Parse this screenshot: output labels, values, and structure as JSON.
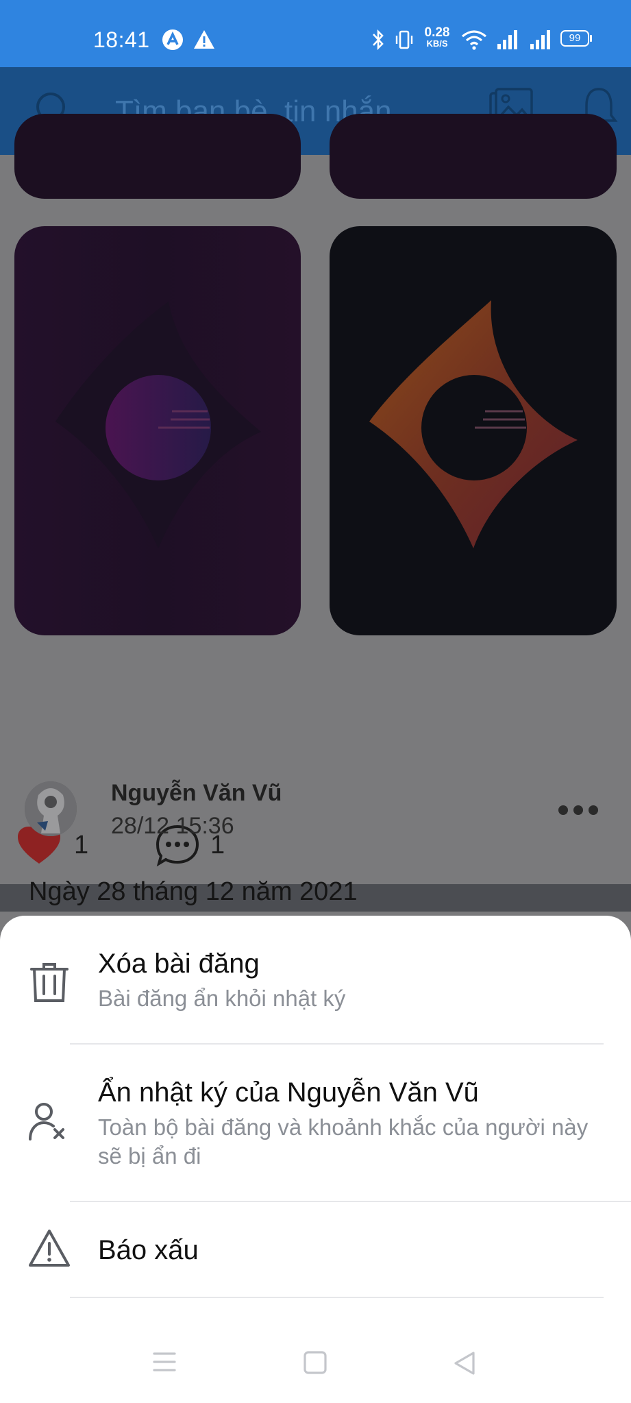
{
  "status_bar": {
    "time": "18:41",
    "speed_value": "0.28",
    "speed_unit": "KB/S",
    "battery": "99"
  },
  "header": {
    "search_placeholder": "Tìm bạn bè, tin nhắn ..."
  },
  "feed": {
    "like_count": "1",
    "comment_count": "1",
    "post": {
      "author": "Nguyễn Văn Vũ",
      "timestamp": "28/12 15:36",
      "body": "Ngày 28 tháng 12 năm 2021"
    }
  },
  "sheet": {
    "options": [
      {
        "title": "Xóa bài đăng",
        "subtitle": "Bài đăng ẩn khỏi nhật ký",
        "icon": "trash-icon"
      },
      {
        "title": "Ẩn nhật ký của Nguyễn Văn Vũ",
        "subtitle": "Toàn bộ bài đăng và khoảnh khắc của người này sẽ bị ẩn đi",
        "icon": "user-remove-icon"
      },
      {
        "title": "Báo xấu",
        "icon": "warning-icon"
      }
    ]
  },
  "colors": {
    "status_bar": "#2f84e0",
    "header_dimmed": "#1a4f86",
    "heart": "#8e2222",
    "sheet_bg": "#ffffff",
    "subtitle_gray": "#8b8f96"
  }
}
